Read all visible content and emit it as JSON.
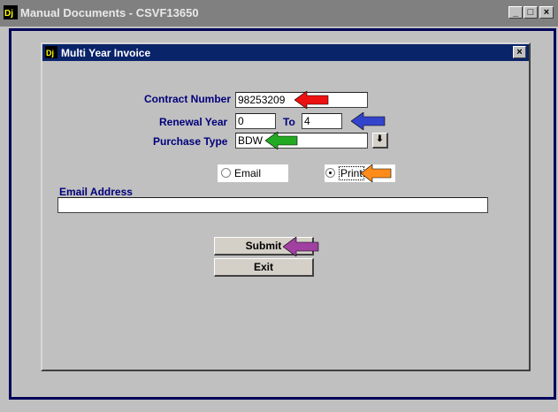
{
  "window": {
    "title": "Manual Documents - CSVF13650"
  },
  "dialog": {
    "title": "Multi Year Invoice"
  },
  "form": {
    "contract_label": "Contract Number",
    "contract_value": "98253209",
    "renewal_label": "Renewal Year",
    "renewal_from": "0",
    "to_label": "To",
    "renewal_to": "4",
    "purchase_label": "Purchase Type",
    "purchase_value": "BDW",
    "email_option": "Email",
    "print_option": "Print",
    "email_label": "Email Address",
    "email_value": "",
    "submit_label": "Submit",
    "exit_label": "Exit"
  },
  "arrows": {
    "red": "#ee1111",
    "blue": "#3344cc",
    "green": "#22aa22",
    "orange": "#ff8c1a",
    "purple": "#a040a0"
  }
}
